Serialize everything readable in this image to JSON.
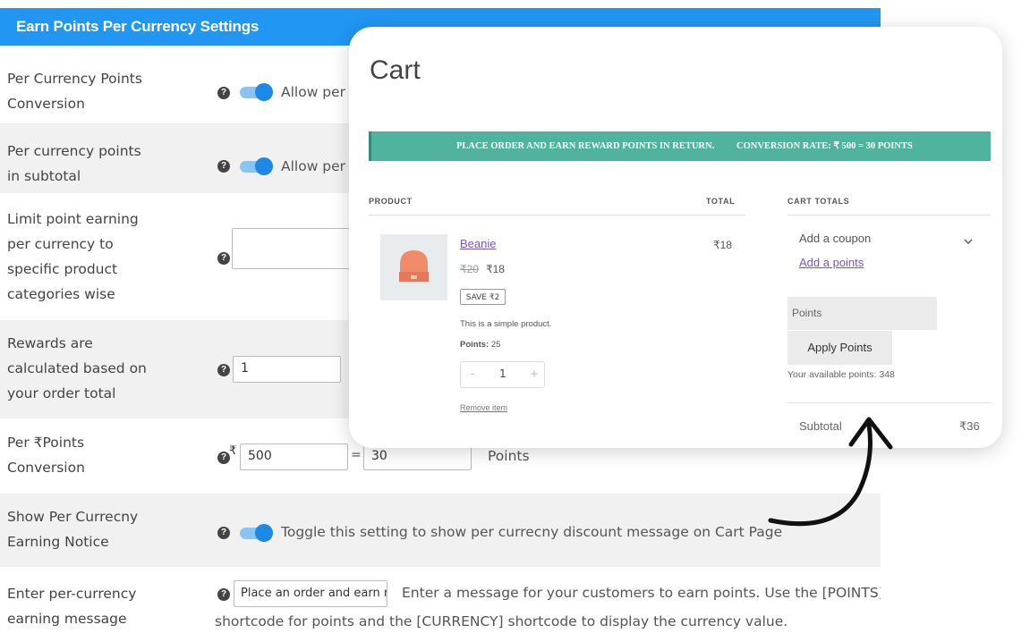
{
  "settings": {
    "header": "Earn Points Per Currency Settings",
    "rows": {
      "per_currency_points_conversion": {
        "label_line1": "Per Currency Points",
        "label_line2": "Conversion",
        "toggle_text": "Allow per c"
      },
      "per_currency_points_subtotal": {
        "label_line1": "Per currency points",
        "label_line2": "in subtotal",
        "toggle_text": "Allow per c"
      },
      "limit_point_earning": {
        "label_line1": "Limit point earning",
        "label_line2": "per currency to",
        "label_line3": "specific product",
        "label_line4": "categories wise"
      },
      "rewards_order_total": {
        "label_line1": "Rewards are",
        "label_line2": "calculated based on",
        "label_line3": "your order total",
        "value": "1"
      },
      "per_points_conversion": {
        "label_line1": "Per ₹Points",
        "label_line2": "Conversion",
        "currency_symbol": "₹",
        "currency_value": "500",
        "equals": "=",
        "points_value": "30",
        "points_label": "Points"
      },
      "show_earning_notice": {
        "label_line1": "Show Per Currecny",
        "label_line2": "Earning Notice",
        "description": "Toggle this setting to show per currecny discount message on Cart Page"
      },
      "earning_message": {
        "label_line1": "Enter per-currency",
        "label_line2": "earning message",
        "value": "Place an order and earn r",
        "description_line1": "Enter a message for your customers to earn points. Use the [POINTS]",
        "description_line2": "shortcode for points and the [CURRENCY] shortcode to display the currency value."
      }
    },
    "help_glyph": "?"
  },
  "cart": {
    "title": "Cart",
    "banner_left": "PLACE ORDER AND EARN REWARD POINTS IN RETURN.",
    "banner_right": "CONVERSION RATE: ₹ 500 = 30 POINTS",
    "col_product": "PRODUCT",
    "col_total": "TOTAL",
    "col_cart_totals": "CART TOTALS",
    "product": {
      "name": "Beanie",
      "old_price": "₹20",
      "price": "₹18",
      "save_badge": "SAVE ₹2",
      "description": "This is a simple product.",
      "points_label": "Points:",
      "points_value": "25",
      "qty_minus": "-",
      "qty_value": "1",
      "qty_plus": "+",
      "remove": "Remove item",
      "total": "₹18"
    },
    "totals": {
      "add_coupon": "Add a coupon",
      "add_points": "Add a points",
      "points_placeholder": "Points",
      "apply_button": "Apply Points",
      "available_points": "Your available points: 348",
      "subtotal_label": "Subtotal",
      "subtotal_value": "₹36"
    }
  },
  "colors": {
    "header_blue": "#2196f3",
    "toggle_blue": "#1e88e5",
    "banner_green": "#4fb39d",
    "link_purple": "#7b55c7",
    "beanie_orange": "#ef8a6a"
  },
  "icons": {
    "help": "help-icon",
    "toggle": "toggle-switch",
    "chevron": "chevron-down-icon",
    "arrow": "curved-arrow-icon",
    "beanie": "beanie-image"
  }
}
